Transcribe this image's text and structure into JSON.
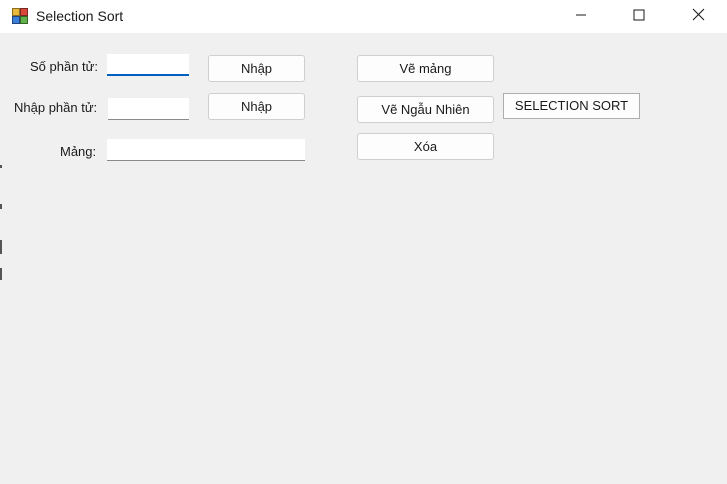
{
  "window": {
    "title": "Selection Sort",
    "controls": {
      "minimize_icon": "minimize-icon",
      "maximize_icon": "maximize-icon",
      "close_icon": "close-icon"
    }
  },
  "form": {
    "count_label": "Số phần tử:",
    "count_value": "",
    "count_submit_label": "Nhập",
    "element_label": "Nhập phần tử:",
    "element_value": "",
    "element_submit_label": "Nhập",
    "array_label": "Mảng:",
    "array_value": ""
  },
  "actions": {
    "draw_array_label": "Vẽ mảng",
    "draw_random_label": "Vẽ Ngẫu Nhiên",
    "clear_label": "Xóa",
    "sort_label": "SELECTION SORT"
  },
  "colors": {
    "window_bg": "#f0f0f0",
    "titlebar_bg": "#ffffff",
    "focus_accent": "#0060c0"
  }
}
